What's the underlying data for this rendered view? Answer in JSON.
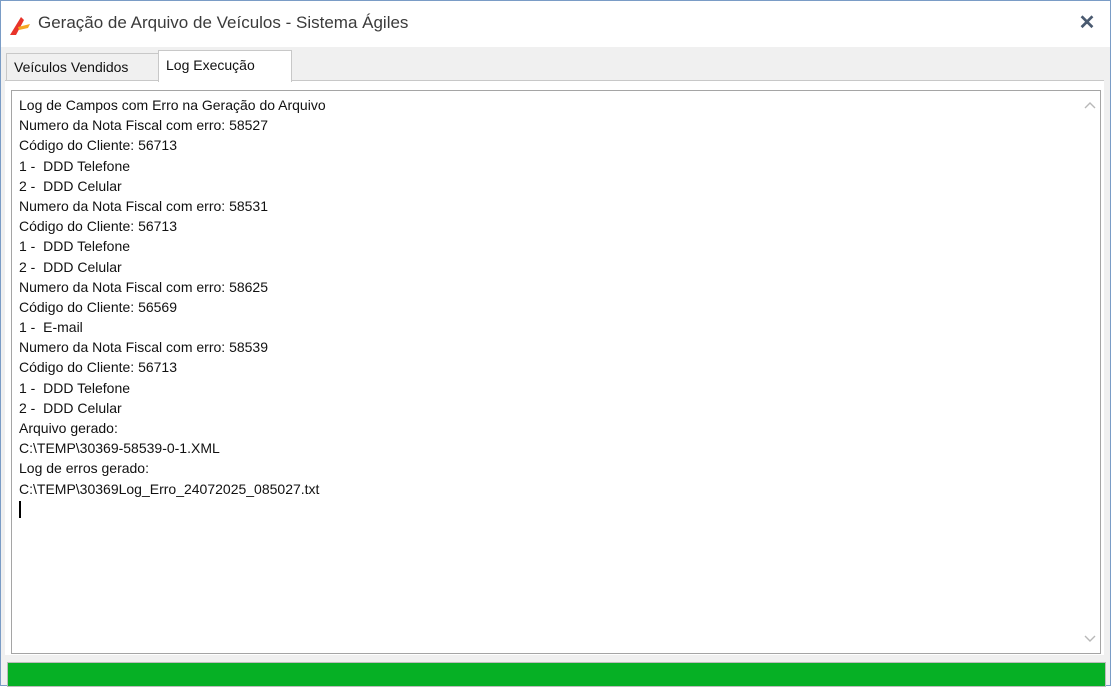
{
  "window": {
    "title": "Geração de Arquivo de Veículos - Sistema Ágiles",
    "close_glyph": "✕"
  },
  "tabs": [
    {
      "label": "Veículos Vendidos",
      "active": false
    },
    {
      "label": "Log Execução",
      "active": true
    }
  ],
  "log": {
    "lines": [
      "Log de Campos com Erro na Geração do Arquivo",
      "Numero da Nota Fiscal com erro: 58527",
      "Código do Cliente: 56713",
      "1 -  DDD Telefone",
      "2 -  DDD Celular",
      "Numero da Nota Fiscal com erro: 58531",
      "Código do Cliente: 56713",
      "1 -  DDD Telefone",
      "2 -  DDD Celular",
      "Numero da Nota Fiscal com erro: 58625",
      "Código do Cliente: 56569",
      "1 -  E-mail",
      "Numero da Nota Fiscal com erro: 58539",
      "Código do Cliente: 56713",
      "1 -  DDD Telefone",
      "2 -  DDD Celular",
      "Arquivo gerado:",
      "C:\\TEMP\\30369-58539-0-1.XML",
      "Log de erros gerado:",
      "C:\\TEMP\\30369Log_Erro_24072025_085027.txt"
    ]
  },
  "progress": {
    "value": 1.0,
    "color": "#06b025"
  },
  "icons": {
    "app": "app-logo-icon",
    "close": "close-icon",
    "scroll_up": "chevron-up-icon",
    "scroll_down": "chevron-down-icon"
  }
}
